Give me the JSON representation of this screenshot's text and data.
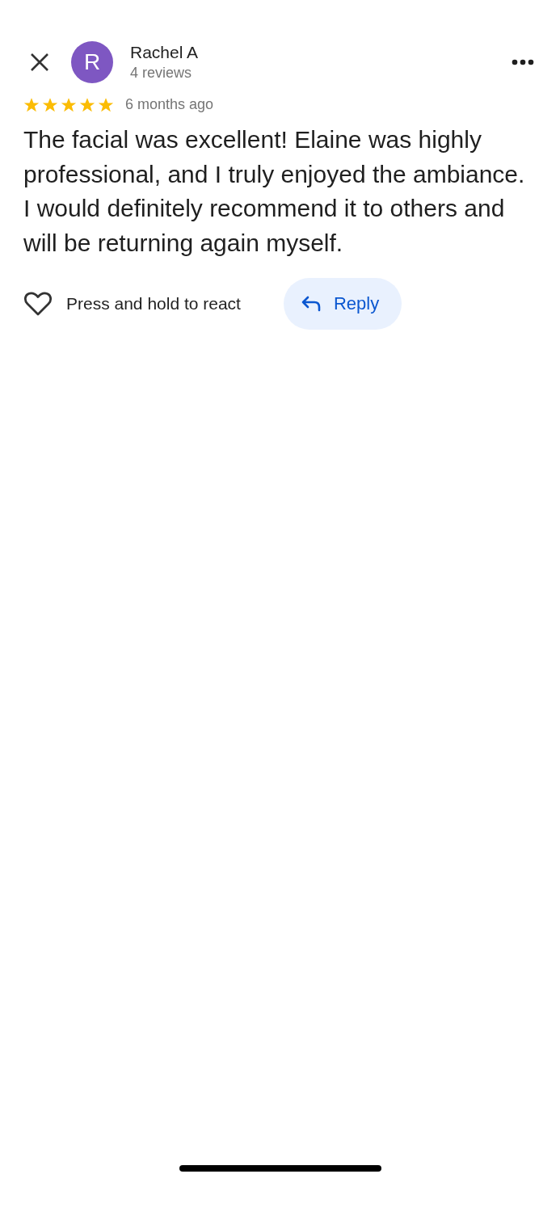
{
  "reviewer": {
    "avatar_letter": "R",
    "name": "Rachel A",
    "review_count": "4 reviews"
  },
  "review": {
    "stars": 5,
    "time": "6 months ago",
    "text": "The facial was excellent! Elaine was highly professional, and I truly enjoyed the ambiance. I would definitely recommend it to others and will be returning again myself."
  },
  "actions": {
    "react_label": "Press and hold to react",
    "reply_label": "Reply"
  }
}
